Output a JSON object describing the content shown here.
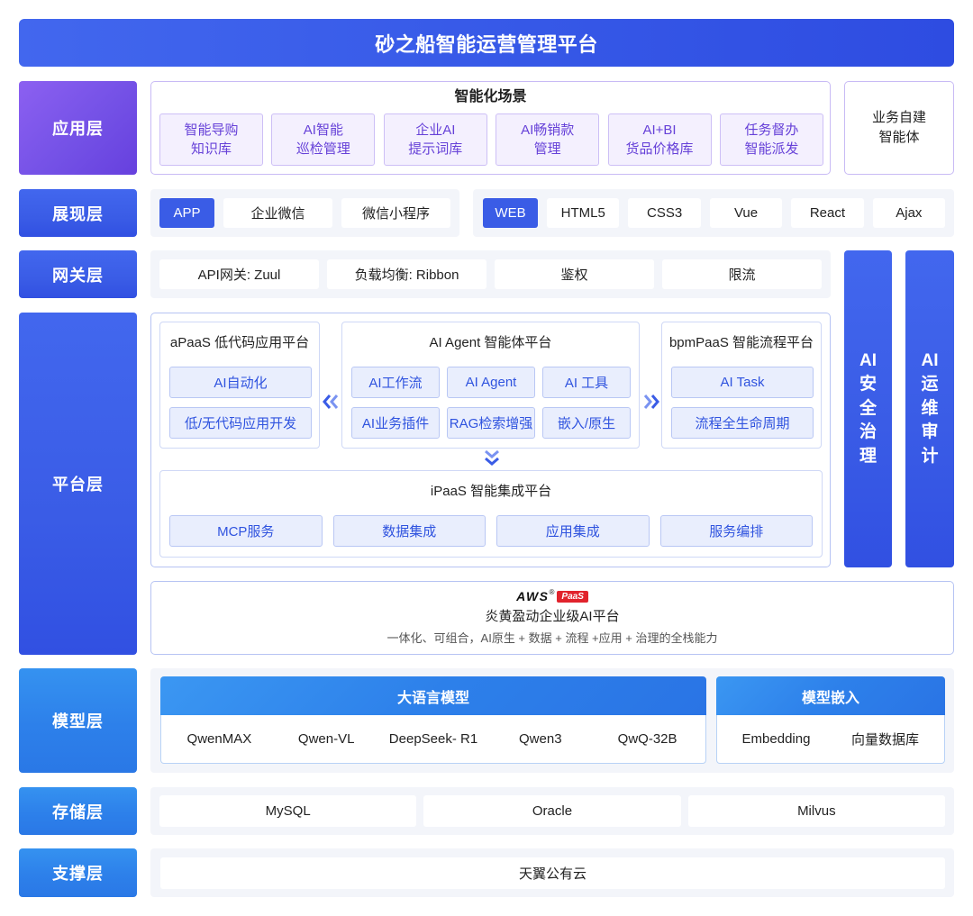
{
  "title": "砂之船智能运营管理平台",
  "colors": {
    "primary": "#3a5ce6",
    "purple": "#7451e6",
    "model_blue": "#2d80ea",
    "aws_red": "#e1232c"
  },
  "icons": {
    "apaas_link": "double-chevron-left-icon",
    "bpmpaas_link": "double-chevron-right-icon",
    "ipaas_link": "double-chevron-down-icon"
  },
  "layers": {
    "application": "应用层",
    "presentation": "展现层",
    "gateway": "网关层",
    "platform": "平台层",
    "model": "模型层",
    "storage": "存储层",
    "support": "支撑层"
  },
  "application": {
    "scenarios_title": "智能化场景",
    "scenarios": [
      {
        "line1": "智能导购",
        "line2": "知识库"
      },
      {
        "line1": "AI智能",
        "line2": "巡检管理"
      },
      {
        "line1": "企业AI",
        "line2": "提示词库"
      },
      {
        "line1": "AI畅销款",
        "line2": "管理"
      },
      {
        "line1": "AI+BI",
        "line2": "货品价格库"
      },
      {
        "line1": "任务督办",
        "line2": "智能派发"
      }
    ],
    "custom_agent": {
      "line1": "业务自建",
      "line2": "智能体"
    }
  },
  "presentation": {
    "mobile": {
      "tag": "APP",
      "items": [
        "企业微信",
        "微信小程序"
      ]
    },
    "web": {
      "tag": "WEB",
      "items": [
        "HTML5",
        "CSS3",
        "Vue",
        "React",
        "Ajax"
      ]
    }
  },
  "gateway": {
    "items": [
      "API网关: Zuul",
      "负载均衡: Ribbon",
      "鉴权",
      "限流"
    ]
  },
  "governance": {
    "security": [
      "AI",
      "安",
      "全",
      "治",
      "理"
    ],
    "ops_audit": [
      "AI",
      "运",
      "维",
      "审",
      "计"
    ]
  },
  "platform": {
    "apaas": {
      "title": "aPaaS 低代码应用平台",
      "items": [
        "AI自动化",
        "低/无代码应用开发"
      ]
    },
    "agent": {
      "title": "AI Agent 智能体平台",
      "items": [
        "AI工作流",
        "AI Agent",
        "AI 工具",
        "AI业务插件",
        "RAG检索增强",
        "嵌入/原生"
      ]
    },
    "bpmpaas": {
      "title": "bpmPaaS 智能流程平台",
      "items": [
        "AI Task",
        "流程全生命周期"
      ]
    },
    "ipaas": {
      "title": "iPaaS 智能集成平台",
      "items": [
        "MCP服务",
        "数据集成",
        "应用集成",
        "服务编排"
      ]
    }
  },
  "aws": {
    "logo_text": "AWS",
    "logo_mark": "®",
    "logo_badge": "PaaS",
    "name": "炎黄盈动企业级AI平台",
    "tagline": "一体化、可组合，AI原生 + 数据 + 流程 +应用 + 治理的全栈能力"
  },
  "model": {
    "llm": {
      "title": "大语言模型",
      "items": [
        "QwenMAX",
        "Qwen-VL",
        "DeepSeek- R1",
        "Qwen3",
        "QwQ-32B"
      ]
    },
    "embedding": {
      "title": "模型嵌入",
      "items": [
        "Embedding",
        "向量数据库"
      ]
    }
  },
  "storage": {
    "items": [
      "MySQL",
      "Oracle",
      "Milvus"
    ]
  },
  "support": {
    "items": [
      "天翼公有云"
    ]
  }
}
